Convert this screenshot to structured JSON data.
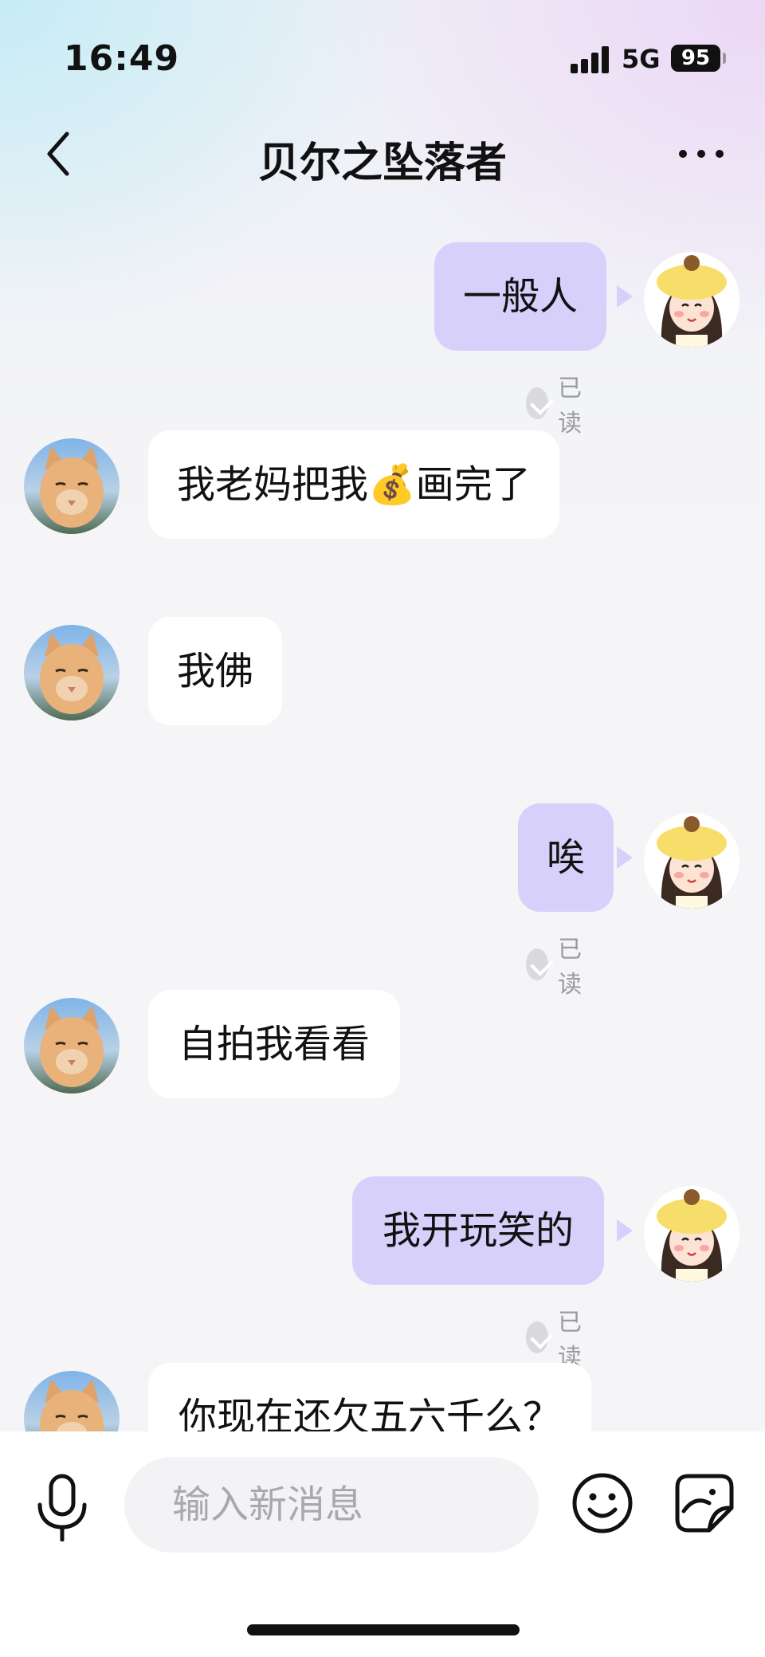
{
  "status_bar": {
    "time": "16:49",
    "network": "5G",
    "battery": "95"
  },
  "header": {
    "title": "贝尔之坠落者"
  },
  "messages": [
    {
      "side": "out",
      "text": "一般人",
      "read": "已读"
    },
    {
      "side": "in",
      "text": "我老妈把我💰画完了"
    },
    {
      "side": "in",
      "text": "我佛"
    },
    {
      "side": "out",
      "text": "唉",
      "read": "已读"
    },
    {
      "side": "in",
      "text": "自拍我看看"
    },
    {
      "side": "out",
      "text": "我开玩笑的",
      "read": "已读"
    },
    {
      "side": "in",
      "text": "你现在还欠五六千么？"
    }
  ],
  "composer": {
    "placeholder": "输入新消息"
  },
  "icons": {
    "back": "chevron-left-icon",
    "more": "more-dots-icon",
    "mic": "microphone-icon",
    "emoji": "smiley-icon",
    "sticker": "sticker-icon",
    "read": "check-circle-icon"
  },
  "colors": {
    "outgoing_bubble": "#d6d0fb",
    "incoming_bubble": "#ffffff"
  }
}
